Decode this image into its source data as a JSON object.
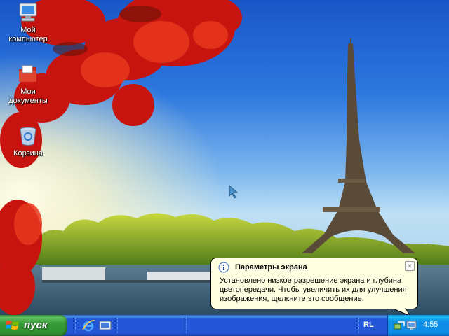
{
  "desktop": {
    "icons": [
      {
        "label": "Мой\nкомпьютер",
        "icon": "my-computer-icon"
      },
      {
        "label": "Мои\nдокументы",
        "icon": "my-documents-icon"
      },
      {
        "label": "Корзина",
        "icon": "recycle-bin-icon"
      }
    ]
  },
  "balloon": {
    "title": "Параметры экрана",
    "text": "Установлено низкое разрешение экрана и глубина цветопередачи. Чтобы увеличить их для улучшения изображения, щелкните это сообщение.",
    "close_label": "×",
    "icon": "info-icon"
  },
  "taskbar": {
    "start_label": "пуск",
    "quick_launch": [
      "internet-explorer-icon",
      "show-desktop-icon"
    ],
    "language": "RL",
    "clock": "4:55",
    "tray_icons": [
      "network-icon",
      "display-settings-icon"
    ]
  },
  "colors": {
    "taskbar_blue": "#2456d8",
    "start_green": "#389d38",
    "tray_blue": "#0f8fe8",
    "balloon_bg": "#ffffe1"
  }
}
